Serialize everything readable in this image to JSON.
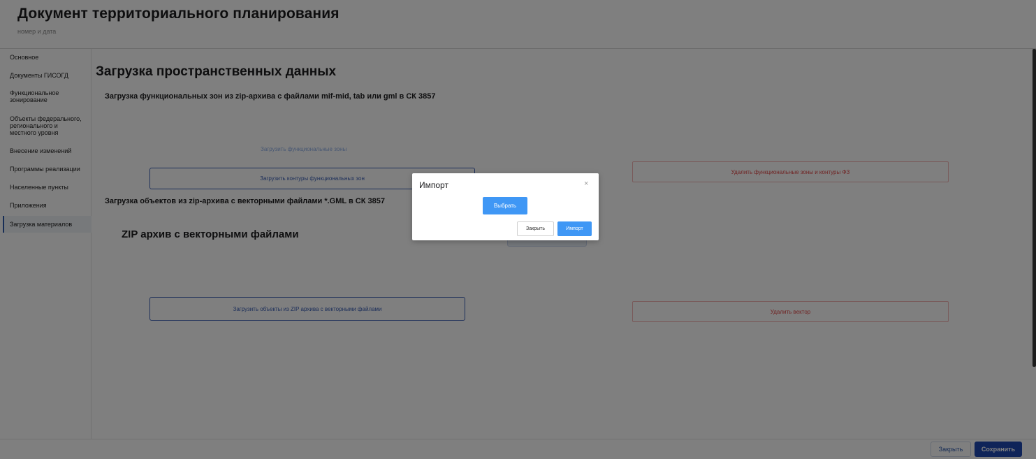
{
  "header": {
    "title": "Документ территориального планирования",
    "subtitle": "номер и дата"
  },
  "sidebar": {
    "items": [
      {
        "label": "Основное"
      },
      {
        "label": "Документы ГИСОГД"
      },
      {
        "label": "Функциональное\nзонирование"
      },
      {
        "label": "Объекты федерального,\nрегионального и\nместного уровня"
      },
      {
        "label": "Внесение изменений"
      },
      {
        "label": "Программы реализации"
      },
      {
        "label": "Населенные пункты"
      },
      {
        "label": "Приложения"
      },
      {
        "label": "Загрузка материалов",
        "active": true
      }
    ]
  },
  "main": {
    "title": "Загрузка пространственных данных",
    "section1": {
      "title": "Загрузка функциональных зон из zip-архива с файлами mif-mid, tab или gml в СК 3857",
      "faded_label": "Загрузить функциональные зоны",
      "upload_button": "Загрузить контуры функциональных зон",
      "delete_button": "Удалить функциональные зоны и контуры ФЗ"
    },
    "section2": {
      "title": "Загрузка объектов из zip-архива с векторными файлами *.GML в СК 3857",
      "zip_title": "ZIP архив с векторными файлами",
      "upload_button": "Загрузить объекты из ZIP архива с векторными файлами",
      "delete_button": "Удалить вектор"
    }
  },
  "footer": {
    "close_label": "Закрыть",
    "save_label": "Сохранить"
  },
  "modal": {
    "title": "Импорт",
    "close_icon": "×",
    "choose_label": "Выбрать",
    "close_label": "Закрыть",
    "import_label": "Импорт"
  },
  "colors": {
    "primary": "#1f48b3",
    "modal_button": "#3f97f5",
    "danger": "#e04848"
  },
  "icons": {
    "modal_close": "close-icon"
  }
}
